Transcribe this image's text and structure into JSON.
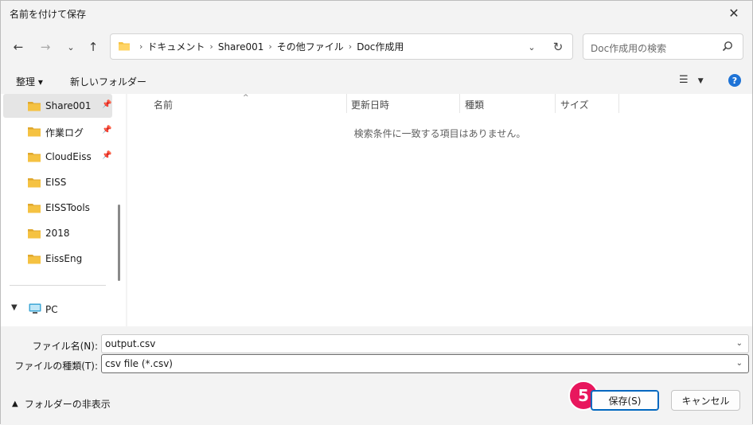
{
  "window": {
    "title": "名前を付けて保存"
  },
  "navigation": {
    "breadcrumbs": [
      "ドキュメント",
      "Share001",
      "その他ファイル",
      "Doc作成用"
    ],
    "search_placeholder": "Doc作成用の検索"
  },
  "commands": {
    "organize": "整理 ▾",
    "new_folder": "新しいフォルダー"
  },
  "sidebar": {
    "items": [
      {
        "label": "Share001",
        "pinned": true,
        "selected": true
      },
      {
        "label": "作業ログ",
        "pinned": true
      },
      {
        "label": "CloudEiss",
        "pinned": true
      },
      {
        "label": "EISS"
      },
      {
        "label": "EISSTools"
      },
      {
        "label": "2018"
      },
      {
        "label": "EissEng"
      }
    ],
    "pc_label": "PC"
  },
  "file_list": {
    "columns": [
      "名前",
      "更新日時",
      "種類",
      "サイズ"
    ],
    "empty_message": "検索条件に一致する項目はありません。"
  },
  "form": {
    "filename_label": "ファイル名(N):",
    "filename_value": "output.csv",
    "filetype_label": "ファイルの種類(T):",
    "filetype_value": "csv file (*.csv)",
    "hide_folders": "フォルダーの非表示",
    "save_button": "保存(S)",
    "cancel_button": "キャンセル",
    "step_number": "5"
  },
  "colors": {
    "folder": "#f5c242",
    "accent": "#0067c0",
    "step_badge": "#e8175d",
    "help": "#1e73d6"
  }
}
